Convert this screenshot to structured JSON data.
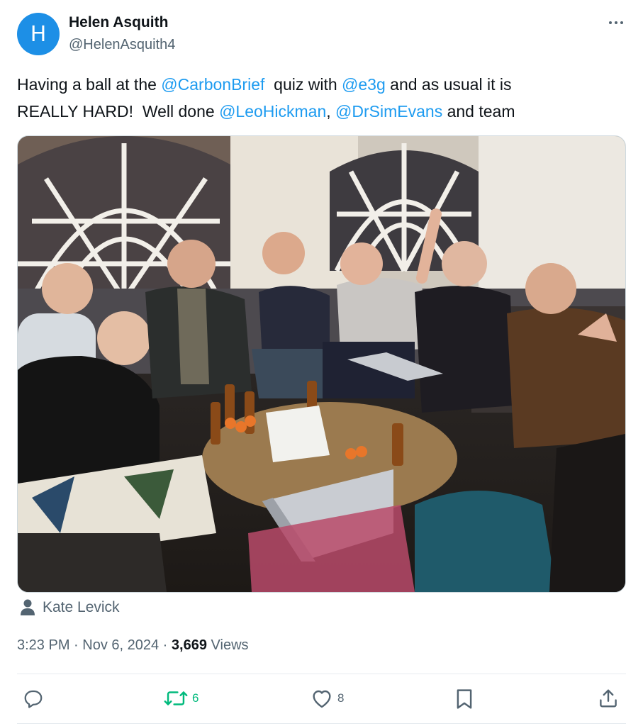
{
  "author": {
    "avatar_letter": "H",
    "avatar_color": "#1d8fe6",
    "display_name": "Helen Asquith",
    "handle": "@HelenAsquith4"
  },
  "tweet": {
    "line1": {
      "t1": "Having a ball at the ",
      "m1": "@CarbonBrief",
      "t2": "  quiz with ",
      "m2": "@e3g",
      "t3": " and as usual it is"
    },
    "line2": {
      "t1": "REALLY HARD!  Well done ",
      "m1": "@LeoHickman",
      "t2": ", ",
      "m2": "@DrSimEvans",
      "t3": " and team"
    },
    "mention_color": "#1d9bf0"
  },
  "tagged_user": {
    "icon": "person-icon",
    "name": "Kate Levick"
  },
  "meta": {
    "time": "3:23 PM",
    "sep1": " · ",
    "date": "Nov 6, 2024",
    "sep2": " · ",
    "views_count": "3,669",
    "views_label": " Views"
  },
  "actions": {
    "reply": {
      "icon": "reply-icon",
      "count": ""
    },
    "retweet": {
      "icon": "retweet-icon",
      "count": "6",
      "color": "#00ba7c"
    },
    "like": {
      "icon": "heart-icon",
      "count": "8"
    },
    "bookmark": {
      "icon": "bookmark-icon",
      "count": ""
    },
    "share": {
      "icon": "share-icon",
      "count": ""
    }
  }
}
